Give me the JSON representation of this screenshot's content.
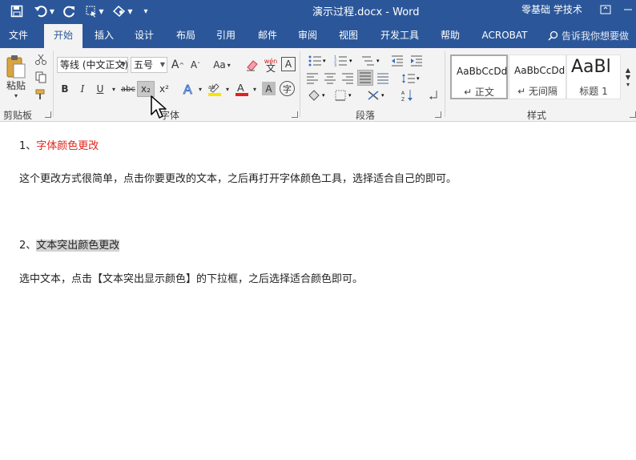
{
  "title_bar": {
    "document_title": "演示过程.docx  -  Word",
    "user": "零基础 学技术",
    "quick_access": [
      "save-icon",
      "undo-icon",
      "redo-icon",
      "select-icon",
      "touch-mode-icon",
      "customize-icon"
    ],
    "window_controls": [
      "ribbon-display-icon",
      "minimize-icon"
    ]
  },
  "tabs": [
    "文件",
    "开始",
    "插入",
    "设计",
    "布局",
    "引用",
    "邮件",
    "审阅",
    "视图",
    "开发工具",
    "帮助",
    "ACROBAT"
  ],
  "active_tab": "开始",
  "tell_me": "告诉我你想要做",
  "ribbon": {
    "clipboard": {
      "label": "剪贴板",
      "paste": "粘贴"
    },
    "font": {
      "label": "字体",
      "font_name": "等线 (中文正文)",
      "font_size": "五号",
      "change_case": "Aa",
      "phonetic": "wén",
      "phonetic_char": "文",
      "char_border": "A",
      "bold": "B",
      "italic": "I",
      "underline": "U",
      "strike": "abc",
      "subscript": "x₂",
      "superscript": "x²",
      "char_shading": "A",
      "enclose": "字",
      "font_color": "#e0231a",
      "highlight_color": "#f5e40a"
    },
    "paragraph": {
      "label": "段落"
    },
    "styles": {
      "label": "样式",
      "items": [
        {
          "sample": "AaBbCcDd",
          "name": "↵ 正文"
        },
        {
          "sample": "AaBbCcDd",
          "name": "↵ 无间隔"
        },
        {
          "sample": "AaBl",
          "name": "标题 1"
        }
      ]
    }
  },
  "document": {
    "p1_prefix": "1、",
    "p1_text": "字体颜色更改",
    "p2": "这个更改方式很简单，点击你要更改的文本，之后再打开字体颜色工具，选择适合自己的即可。",
    "p3_prefix": "2、",
    "p3_text": "文本突出颜色更改",
    "p4": "选中文本，点击【文本突出显示颜色】的下拉框，之后选择适合颜色即可。"
  }
}
